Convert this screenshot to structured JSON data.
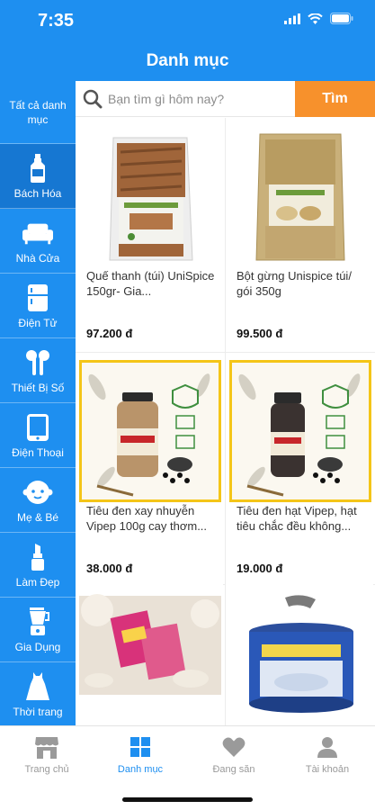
{
  "status": {
    "time": "7:35"
  },
  "header": {
    "title": "Danh mục"
  },
  "search": {
    "placeholder": "Bạn tìm gì hôm nay?",
    "button": "Tìm"
  },
  "sidebar": {
    "items": [
      {
        "label": "Tất cả danh mục",
        "icon": "none"
      },
      {
        "label": "Bách Hóa",
        "icon": "bottle-icon",
        "selected": true
      },
      {
        "label": "Nhà Cửa",
        "icon": "sofa-icon"
      },
      {
        "label": "Điện Tử",
        "icon": "fridge-icon"
      },
      {
        "label": "Thiết Bị Số",
        "icon": "earbuds-icon"
      },
      {
        "label": "Điện Thoại",
        "icon": "tablet-icon"
      },
      {
        "label": "Mẹ & Bé",
        "icon": "baby-face-icon"
      },
      {
        "label": "Làm Đẹp",
        "icon": "lipstick-icon"
      },
      {
        "label": "Gia Dụng",
        "icon": "blender-icon"
      },
      {
        "label": "Thời trang",
        "icon": "dress-icon"
      }
    ]
  },
  "products": [
    {
      "name": "Quế thanh (túi) UniSpice 150gr- Gia...",
      "price": "97.200 đ"
    },
    {
      "name": "Bột gừng Unispice túi/ gói 350g",
      "price": "99.500 đ"
    },
    {
      "name": "Tiêu đen xay nhuyễn Vipep 100g cay thơm...",
      "price": "38.000 đ"
    },
    {
      "name": "Tiêu đen hạt Vipep, hạt tiêu chắc đều không...",
      "price": "19.000 đ"
    }
  ],
  "tabs": [
    {
      "label": "Trang chủ",
      "icon": "store-icon"
    },
    {
      "label": "Danh mục",
      "icon": "grid-icon",
      "active": true
    },
    {
      "label": "Đang săn",
      "icon": "heart-icon"
    },
    {
      "label": "Tài khoản",
      "icon": "user-icon"
    }
  ],
  "colors": {
    "primary": "#1e8ff0",
    "accent": "#f7912c",
    "selected": "#1677d2",
    "frame": "#f4c518"
  }
}
